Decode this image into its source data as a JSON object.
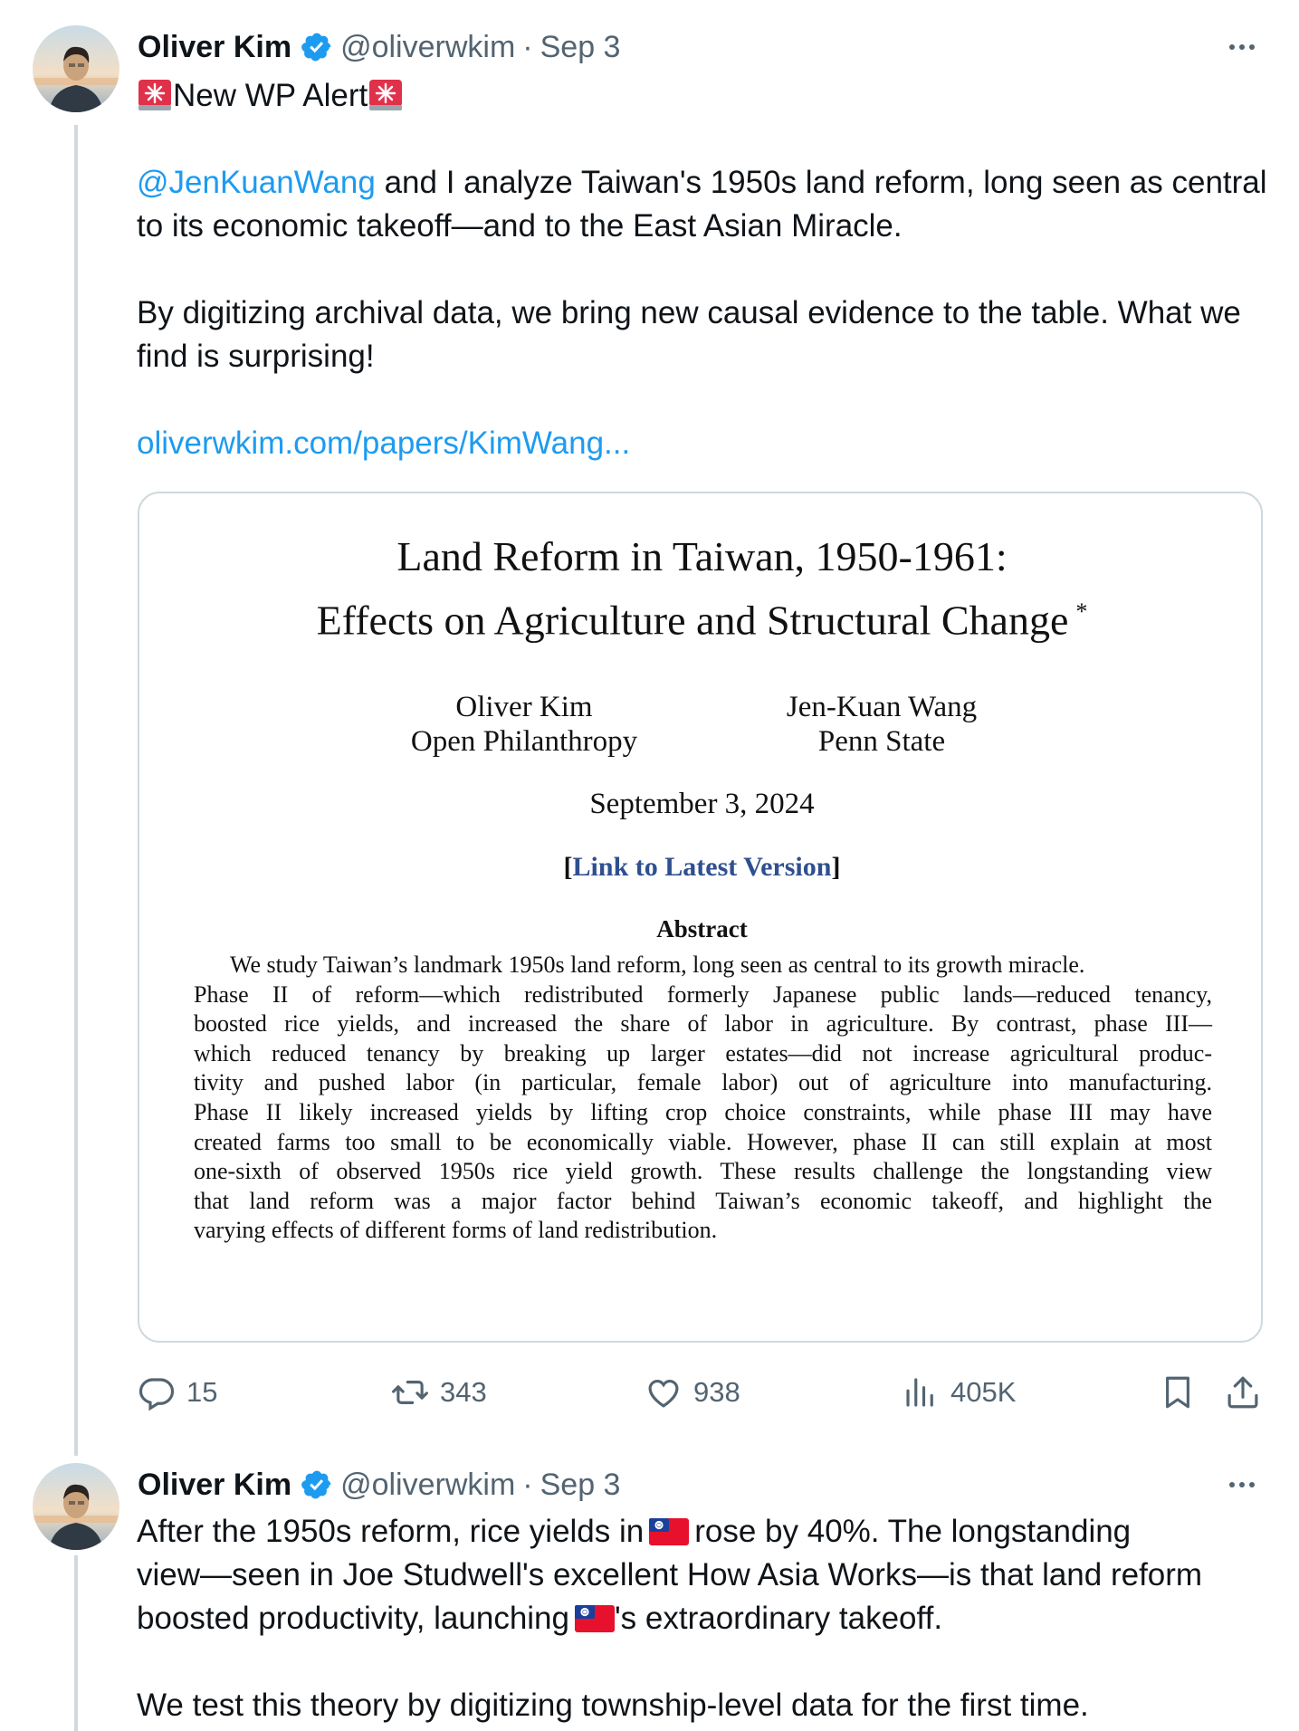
{
  "tweets": [
    {
      "author_name": "Oliver Kim",
      "handle": "@oliverwkim",
      "sep": "·",
      "date": "Sep 3",
      "alert_text": "New WP Alert",
      "mention": "@JenKuanWang",
      "para1_rest": " and I analyze Taiwan's 1950s land reform, long seen as central to its economic takeoff—and to the East Asian Miracle.",
      "para2": "By digitizing archival data, we bring new causal evidence to the table. What we find is surprising!",
      "link": "oliverwkim.com/papers/KimWang...",
      "card": {
        "title_line1": "Land Reform in Taiwan, 1950-1961:",
        "title_line2": "Effects on Agriculture and Structural Change",
        "title_mark": "*",
        "author1_name": "Oliver Kim",
        "author1_affil": "Open Philanthropy",
        "author2_name": "Jen-Kuan Wang",
        "author2_affil": "Penn State",
        "date": "September 3, 2024",
        "bracket_open": "[",
        "link_text": "Link to Latest Version",
        "bracket_close": "]",
        "abstract_heading": "Abstract",
        "abstract_lines": [
          "We study Taiwan’s landmark 1950s land reform, long seen as central to its growth miracle.",
          "Phase II of reform—which redistributed formerly Japanese public lands—reduced tenancy,",
          "boosted rice yields, and increased the share of labor in agriculture. By contrast, phase III—",
          "which reduced tenancy by breaking up larger estates—did not increase agricultural produc-",
          "tivity and pushed labor (in particular, female labor) out of agriculture into manufacturing.",
          "Phase II likely increased yields by lifting crop choice constraints, while phase III may have",
          "created farms too small to be economically viable. However, phase II can still explain at most",
          "one-sixth of observed 1950s rice yield growth. These results challenge the longstanding view",
          "that land reform was a major factor behind Taiwan’s economic takeoff, and highlight the",
          "varying effects of different forms of land redistribution."
        ]
      },
      "stats": {
        "replies": "15",
        "reposts": "343",
        "likes": "938",
        "views": "405K"
      }
    },
    {
      "author_name": "Oliver Kim",
      "handle": "@oliverwkim",
      "sep": "·",
      "date": "Sep 3",
      "line1_a": "After the 1950s reform, rice yields in",
      "line1_b": "rose by 40%. The longstanding",
      "line2": "view—seen in Joe Studwell's excellent How Asia Works—is that land reform",
      "line3_a": "boosted productivity, launching",
      "line3_b": "'s extraordinary takeoff.",
      "para2": "We test this theory by digitizing township-level data for the first time."
    }
  ],
  "icons": {
    "verified": "verified-badge-icon",
    "siren": "siren-emoji-icon",
    "flag": "taiwan-flag-emoji-icon",
    "reply": "reply-icon",
    "repost": "repost-icon",
    "like": "heart-icon",
    "views": "views-icon",
    "bookmark": "bookmark-icon",
    "share": "share-icon"
  },
  "colors": {
    "link": "#1d9bf0",
    "verified": "#1d9bf0",
    "secondary_text": "#536471",
    "paper_link": "#2f4f8f",
    "border": "#cfd9de"
  }
}
